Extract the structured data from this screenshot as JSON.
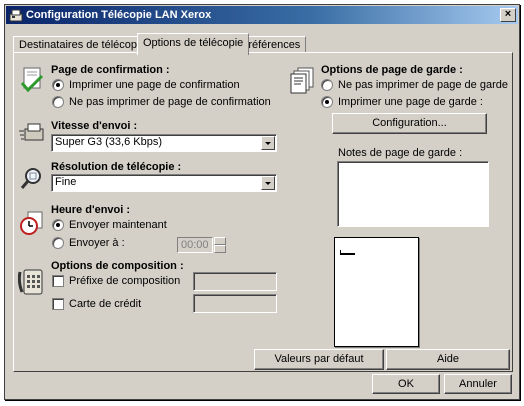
{
  "window": {
    "title": "Configuration Télécopie LAN Xerox",
    "close": "×"
  },
  "tabs": [
    {
      "label": "Destinataires de télécopie",
      "active": false
    },
    {
      "label": "Options de télécopie",
      "active": true
    },
    {
      "label": "Préférences",
      "active": false
    }
  ],
  "confirmation": {
    "title": "Page de confirmation :",
    "options": [
      {
        "label": "Imprimer une page de confirmation",
        "checked": true
      },
      {
        "label": "Ne pas imprimer de page de confirmation",
        "checked": false
      }
    ]
  },
  "speed": {
    "title": "Vitesse d'envoi :",
    "value": "Super G3 (33,6 Kbps)"
  },
  "resolution": {
    "title": "Résolution de télécopie :",
    "value": "Fine"
  },
  "send_time": {
    "title": "Heure d'envoi :",
    "options": [
      {
        "label": "Envoyer maintenant",
        "checked": true
      },
      {
        "label": "Envoyer à :",
        "checked": false
      }
    ],
    "time_value": "00:00"
  },
  "composition": {
    "title": "Options de composition :",
    "prefix_label": "Préfixe de composition",
    "credit_label": "Carte de crédit",
    "prefix_value": "",
    "credit_value": ""
  },
  "cover": {
    "title": "Options de page de garde :",
    "options": [
      {
        "label": "Ne pas imprimer de page de garde",
        "checked": false
      },
      {
        "label": "Imprimer une page de garde :",
        "checked": true
      }
    ],
    "config_button": "Configuration...",
    "notes_label": "Notes de page de garde :",
    "notes_value": ""
  },
  "panel_buttons": {
    "defaults": "Valeurs par défaut",
    "help": "Aide"
  },
  "footer": {
    "ok": "OK",
    "cancel": "Annuler"
  }
}
